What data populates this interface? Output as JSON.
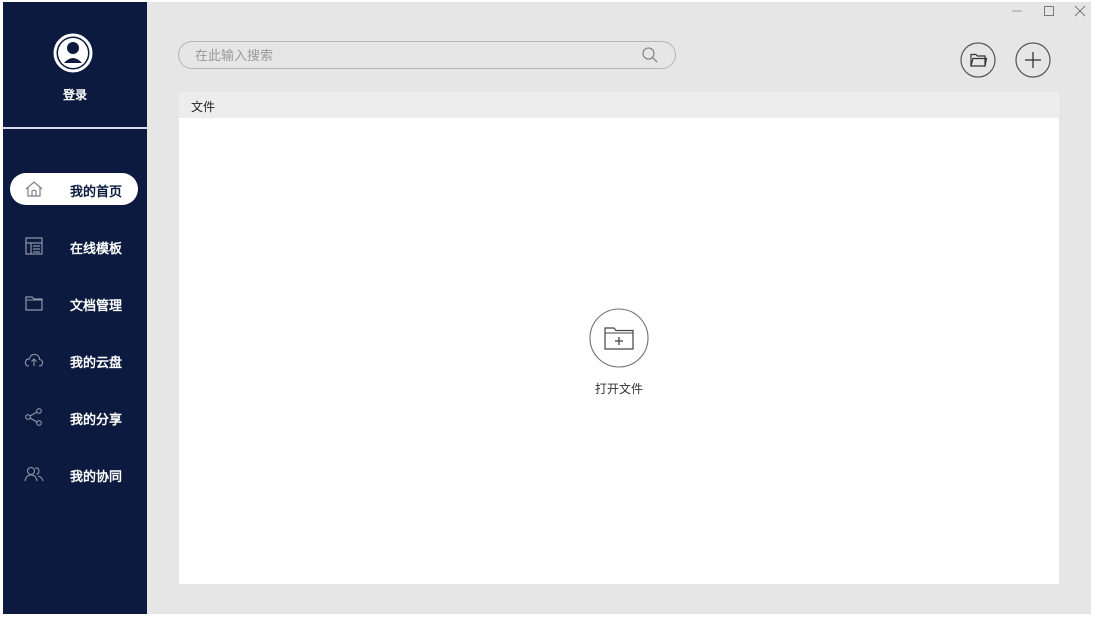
{
  "sidebar": {
    "login_label": "登录",
    "items": [
      {
        "label": "我的首页",
        "icon": "home-icon",
        "active": true
      },
      {
        "label": "在线模板",
        "icon": "template-icon",
        "active": false
      },
      {
        "label": "文档管理",
        "icon": "folder-icon",
        "active": false
      },
      {
        "label": "我的云盘",
        "icon": "cloud-upload-icon",
        "active": false
      },
      {
        "label": "我的分享",
        "icon": "share-icon",
        "active": false
      },
      {
        "label": "我的协同",
        "icon": "collaborate-icon",
        "active": false
      }
    ]
  },
  "search": {
    "placeholder": "在此输入搜索",
    "value": ""
  },
  "toolbar": {
    "open_folder_icon": "open-folder-icon",
    "add_icon": "plus-icon"
  },
  "window": {
    "minimize_icon": "minimize-icon",
    "maximize_icon": "maximize-icon",
    "close_icon": "close-icon"
  },
  "main": {
    "panel_title": "文件",
    "open_file_label": "打开文件"
  },
  "colors": {
    "sidebar_bg": "#0b1a3e",
    "app_bg": "#e6e6e6",
    "panel_bg": "#ffffff",
    "accent": "#0b1a3e"
  }
}
